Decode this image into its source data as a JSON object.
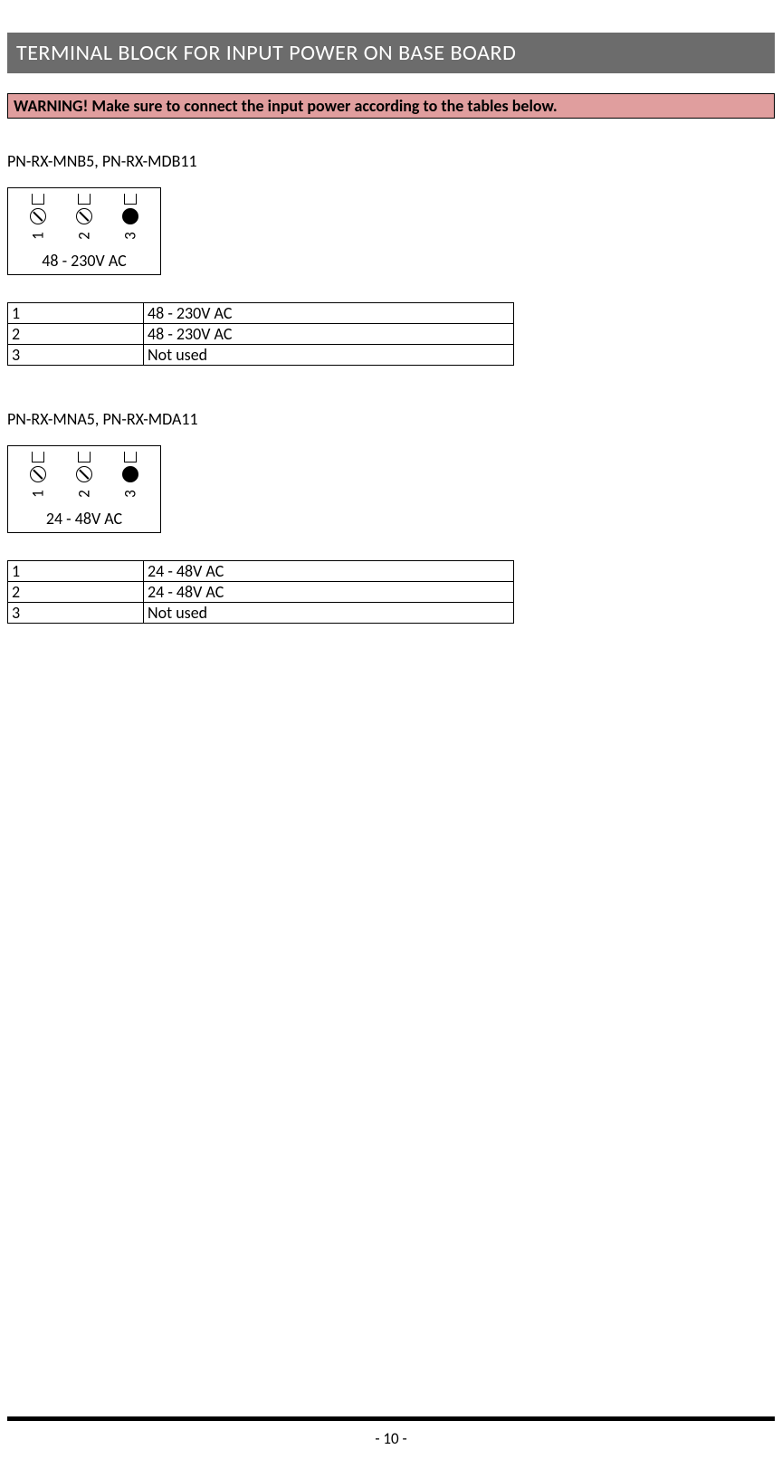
{
  "section_title": "TERMINAL BLOCK FOR INPUT POWER ON BASE BOARD",
  "warning_text": "WARNING! Make sure to connect the input power according to the tables below.",
  "blocks": [
    {
      "heading": "PN-RX-MNB5, PN-RX-MDB11",
      "diagram_label": "48 - 230V AC",
      "pins": {
        "n1": "1",
        "n2": "2",
        "n3": "3"
      },
      "rows": [
        {
          "pin": "1",
          "desc": "48 - 230V AC"
        },
        {
          "pin": "2",
          "desc": "48 - 230V AC"
        },
        {
          "pin": "3",
          "desc": "Not used"
        }
      ]
    },
    {
      "heading": "PN-RX-MNA5, PN-RX-MDA11",
      "diagram_label": "24 - 48V AC",
      "pins": {
        "n1": "1",
        "n2": "2",
        "n3": "3"
      },
      "rows": [
        {
          "pin": "1",
          "desc": "24 - 48V AC"
        },
        {
          "pin": "2",
          "desc": "24 - 48V AC"
        },
        {
          "pin": "3",
          "desc": "Not used"
        }
      ]
    }
  ],
  "page_number": "- 10 -"
}
